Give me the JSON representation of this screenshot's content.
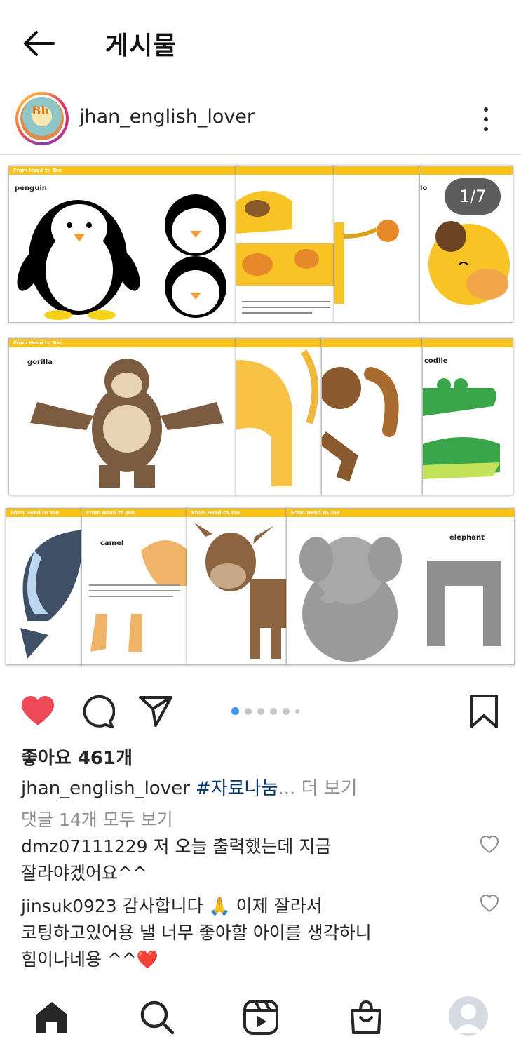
{
  "header": {
    "title": "게시물",
    "back_icon": "arrow-left-icon"
  },
  "post": {
    "username": "jhan_english_lover",
    "avatar_text": "Bb",
    "media_counter": "1/7",
    "sheet_header": "From Head to Toe",
    "sheet_labels": {
      "penguin": "penguin",
      "gorilla": "gorilla",
      "crocodile": "codile",
      "camel": "camel",
      "elephant": "elephant",
      "frag": "lo"
    },
    "carousel": {
      "total": 7,
      "current": 1
    }
  },
  "actions": {
    "like_icon": "heart-filled-icon",
    "comment_icon": "comment-icon",
    "share_icon": "send-icon",
    "save_icon": "bookmark-icon"
  },
  "likes_text": "좋아요 461개",
  "caption": {
    "username": "jhan_english_lover",
    "hashtag": "#자료나눔",
    "ellipsis": "...",
    "more": " 더 보기"
  },
  "view_comments": "댓글 14개 모두 보기",
  "comments": [
    {
      "username": "dmz07111229",
      "line1": " 저 오늘 출력했는데 지금",
      "line2": "잘라야겠어요^^"
    },
    {
      "username": "jinsuk0923",
      "line1": " 감사합니다 🙏  이제 잘라서",
      "line2": "코팅하고있어용 낼 너무 좋아할 아이를 생각하니",
      "line3": "힘이나네용 ^^❤️"
    }
  ],
  "colors": {
    "like_red": "#ed4956",
    "link_blue": "#00376b",
    "active_dot": "#3897f0",
    "sheet_yellow": "#f9c31a"
  },
  "nav": [
    "home-icon",
    "search-icon",
    "reels-icon",
    "shop-icon",
    "profile-avatar"
  ]
}
